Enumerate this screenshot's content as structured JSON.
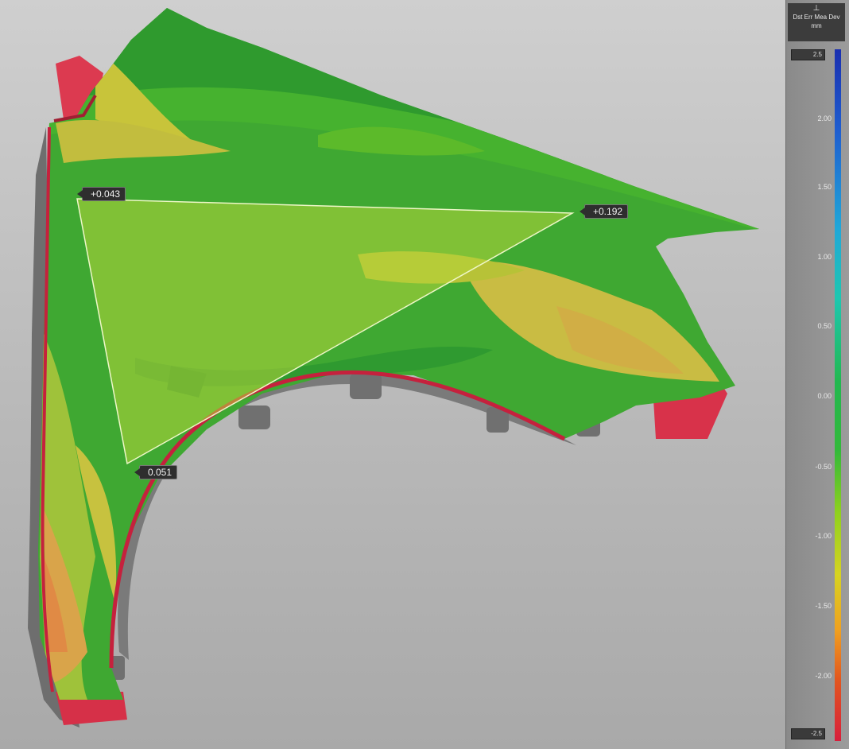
{
  "viewport": {
    "callouts": [
      {
        "id": "p1",
        "value": "+0.043"
      },
      {
        "id": "p2",
        "value": "+0.192"
      },
      {
        "id": "p3",
        "value": "0.051"
      }
    ]
  },
  "legend": {
    "title": "Dst Err Mea Dev",
    "unit": "mm",
    "top_limit": "2.5",
    "bottom_limit": "-2.5",
    "ticks": [
      "2.00",
      "1.50",
      "1.00",
      "0.50",
      "0.00",
      "-0.50",
      "-1.00",
      "-1.50",
      "-2.00"
    ],
    "colors": [
      "#1a2fb0",
      "#1f5fd0",
      "#20a8d8",
      "#22b850",
      "#8fd11e",
      "#d7d321",
      "#f0a020",
      "#e2571e",
      "#d81e3c"
    ]
  }
}
